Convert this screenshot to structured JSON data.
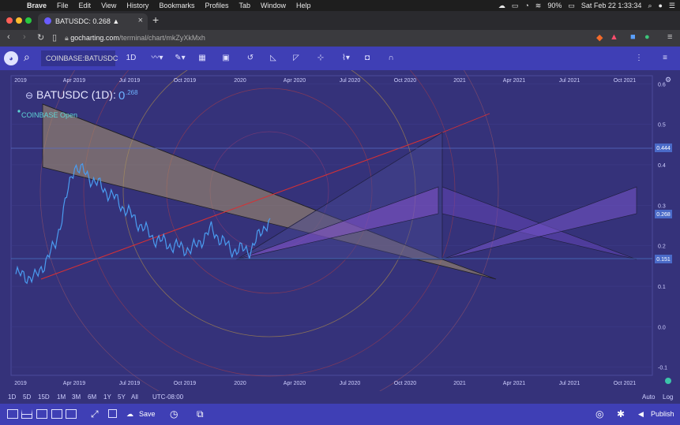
{
  "mac_menubar": {
    "apple": "",
    "items": [
      "Brave",
      "File",
      "Edit",
      "View",
      "History",
      "Bookmarks",
      "Profiles",
      "Tab",
      "Window",
      "Help"
    ],
    "battery": "90%",
    "clock": "Sat Feb 22  1:33:34"
  },
  "browser": {
    "tab_title": "BATUSDC: 0.268 ▲",
    "url_host": "gocharting.com",
    "url_path": "/terminal/chart/mkZyXkMxh"
  },
  "toolbar": {
    "symbol": "COINBASE:BATUSDC",
    "interval": "1D"
  },
  "chart": {
    "title": "BATUSDC (1D):",
    "price_big": "0",
    "price_small": ".268",
    "session": "COINBASE Open",
    "x_ticks": [
      "2019",
      "Apr 2019",
      "Jul 2019",
      "Oct 2019",
      "2020",
      "Apr 2020",
      "Jul 2020",
      "Oct 2020",
      "2021",
      "Apr 2021",
      "Jul 2021",
      "Oct 2021"
    ],
    "y_ticks": [
      "0.6",
      "0.5",
      "0.4",
      "0.3",
      "0.2",
      "0.1",
      "0.0",
      "-0.1"
    ],
    "tags": [
      "0.444",
      "0.268",
      "0.151"
    ]
  },
  "timebar": {
    "ranges": [
      "1D",
      "5D",
      "15D",
      "1M",
      "3M",
      "6M",
      "1Y",
      "5Y",
      "All"
    ],
    "timezone": "UTC-08:00",
    "auto": "Auto",
    "log": "Log"
  },
  "bottom": {
    "save": "Save",
    "publish": "Publish"
  },
  "chart_data": {
    "type": "line",
    "x": [
      "2019-01",
      "2019-02",
      "2019-03",
      "2019-04",
      "2019-05",
      "2019-06",
      "2019-07",
      "2019-08",
      "2019-09",
      "2019-10",
      "2019-11",
      "2019-12",
      "2020-01",
      "2020-02"
    ],
    "y": [
      0.13,
      0.12,
      0.2,
      0.4,
      0.36,
      0.32,
      0.27,
      0.22,
      0.2,
      0.19,
      0.24,
      0.19,
      0.19,
      0.27
    ],
    "last": 0.268,
    "ylim": [
      -0.12,
      0.62
    ],
    "xlabel": "",
    "ylabel": ""
  }
}
